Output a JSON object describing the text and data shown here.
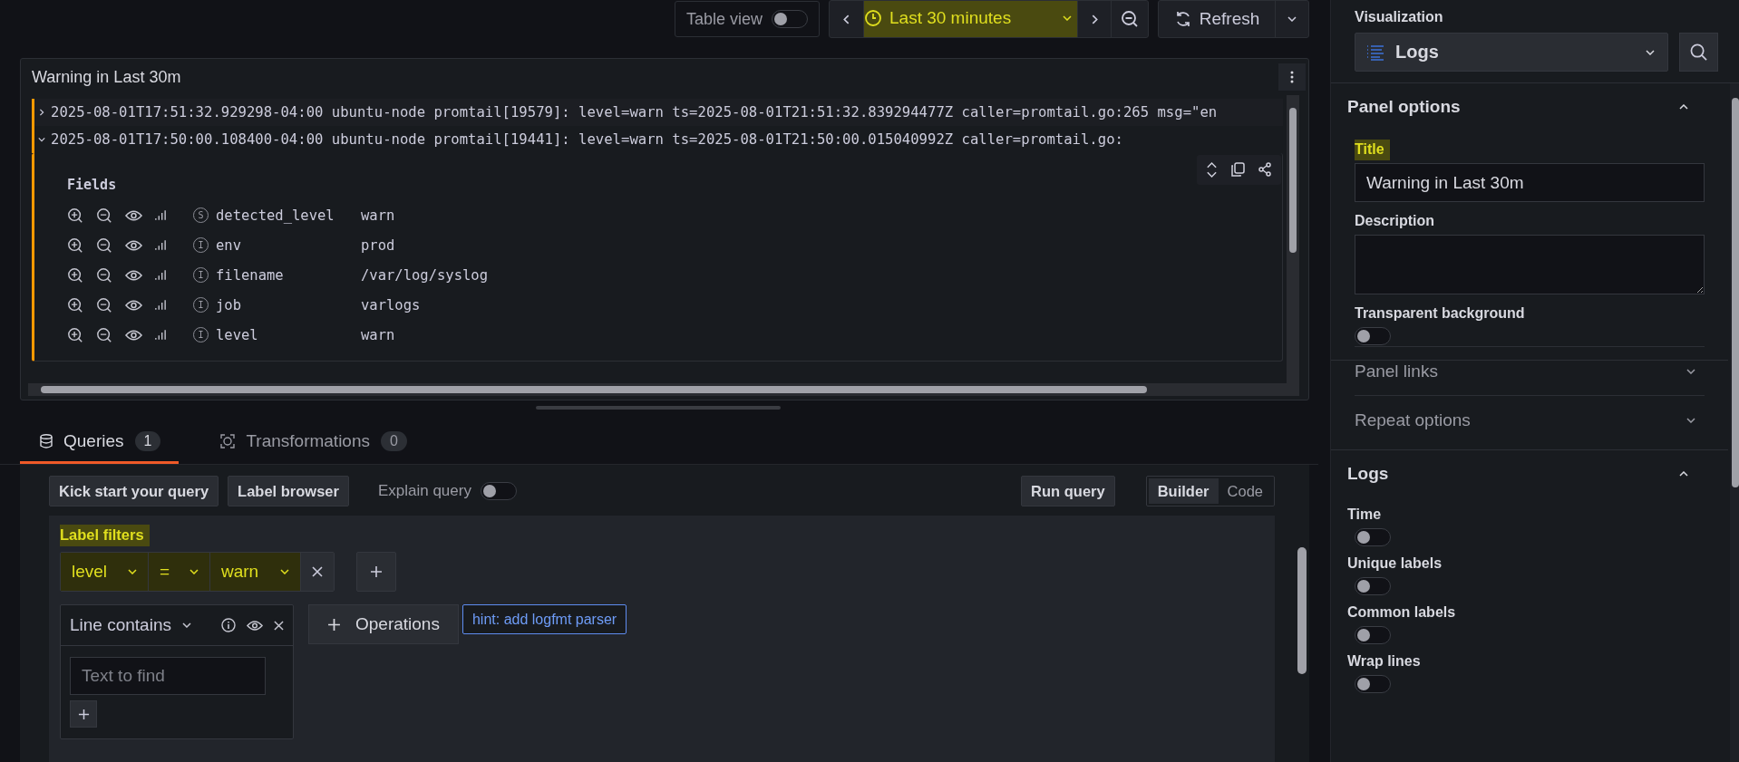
{
  "toolbar": {
    "table_view": {
      "label": "Table view",
      "on": false
    },
    "time_range": {
      "label": "Last 30 minutes",
      "highlighted": true
    },
    "refresh": {
      "label": "Refresh"
    }
  },
  "panel": {
    "title": "Warning in Last 30m",
    "log_lines": [
      {
        "text": "2025-08-01T17:51:32.929298-04:00 ubuntu-node promtail[19579]: level=warn ts=2025-08-01T21:51:32.839294477Z caller=promtail.go:265 msg=\"en",
        "expanded": false
      },
      {
        "text": "2025-08-01T17:50:00.108400-04:00 ubuntu-node promtail[19441]: level=warn ts=2025-08-01T21:50:00.015040992Z caller=promtail.go:",
        "expanded": true
      }
    ],
    "fields_heading": "Fields",
    "fields": [
      {
        "type": "S",
        "name": "detected_level",
        "value": "warn"
      },
      {
        "type": "I",
        "name": "env",
        "value": "prod"
      },
      {
        "type": "I",
        "name": "filename",
        "value": "/var/log/syslog"
      },
      {
        "type": "I",
        "name": "job",
        "value": "varlogs"
      },
      {
        "type": "I",
        "name": "level",
        "value": "warn"
      }
    ]
  },
  "query_tabs": [
    {
      "label": "Queries",
      "count": "1",
      "selected": true
    },
    {
      "label": "Transformations",
      "count": "0",
      "selected": false
    }
  ],
  "query_toolbar": {
    "buttons": [
      "Kick start your query",
      "Label browser"
    ],
    "explain": {
      "label": "Explain query",
      "on": false
    },
    "run": "Run query",
    "modes": [
      {
        "label": "Builder",
        "selected": true
      },
      {
        "label": "Code",
        "selected": false
      }
    ]
  },
  "label_filters": {
    "heading": "Label filters",
    "highlighted": true,
    "filters": [
      {
        "label": "level",
        "operator": "=",
        "value": "warn",
        "highlighted": true
      }
    ]
  },
  "operation": {
    "title": "Line contains",
    "placeholder": "Text to find"
  },
  "operations_button": "Operations",
  "hint": "hint: add logfmt parser",
  "options": {
    "visualization_label": "Visualization",
    "visualization": "Logs",
    "sections": [
      {
        "title": "Panel options",
        "expanded": true,
        "kind": "panel"
      },
      {
        "title": "Panel links",
        "expanded": false,
        "kind": "collapsed"
      },
      {
        "title": "Repeat options",
        "expanded": false,
        "kind": "collapsed"
      },
      {
        "title": "Logs",
        "expanded": true,
        "kind": "logs"
      }
    ],
    "title_field": {
      "label": "Title",
      "value": "Warning in Last 30m",
      "highlighted": true
    },
    "description_label": "Description",
    "transparent": {
      "label": "Transparent background",
      "on": false
    },
    "log_toggles": [
      {
        "label": "Time",
        "on": false
      },
      {
        "label": "Unique labels",
        "on": false
      },
      {
        "label": "Common labels",
        "on": false
      },
      {
        "label": "Wrap lines",
        "on": false
      }
    ]
  }
}
